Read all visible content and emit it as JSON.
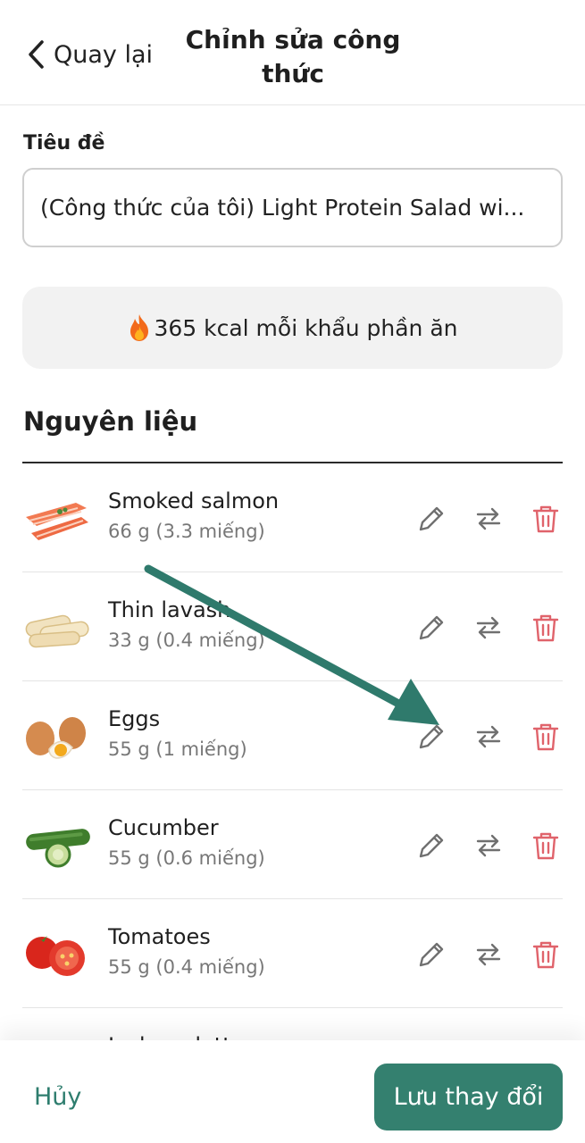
{
  "header": {
    "back_label": "Quay lại",
    "title": "Chỉnh sửa công thức"
  },
  "recipe": {
    "title_label": "Tiêu đề",
    "title_value": "(Công thức của tôi) Light Protein Salad wi...",
    "kcal_text": "365 kcal mỗi khẩu phần ăn"
  },
  "ingredients": {
    "section_title": "Nguyên liệu",
    "items": [
      {
        "name": "Smoked salmon",
        "qty": "66 g (3.3 miếng)",
        "image": "salmon-image"
      },
      {
        "name": "Thin lavash",
        "qty": "33 g (0.4 miếng)",
        "image": "lavash-image"
      },
      {
        "name": "Eggs",
        "qty": "55 g (1 miếng)",
        "image": "eggs-image"
      },
      {
        "name": "Cucumber",
        "qty": "55 g (0.6 miếng)",
        "image": "cucumber-image"
      },
      {
        "name": "Tomatoes",
        "qty": "55 g (0.4 miếng)",
        "image": "tomatoes-image"
      },
      {
        "name": "Iceberg lettuce",
        "qty": "",
        "image": "lettuce-image"
      }
    ]
  },
  "footer": {
    "cancel_label": "Hủy",
    "save_label": "Lưu thay đổi"
  },
  "colors": {
    "accent": "#34806f",
    "delete": "#e0636b",
    "annotation_arrow": "#2f7a6c"
  }
}
